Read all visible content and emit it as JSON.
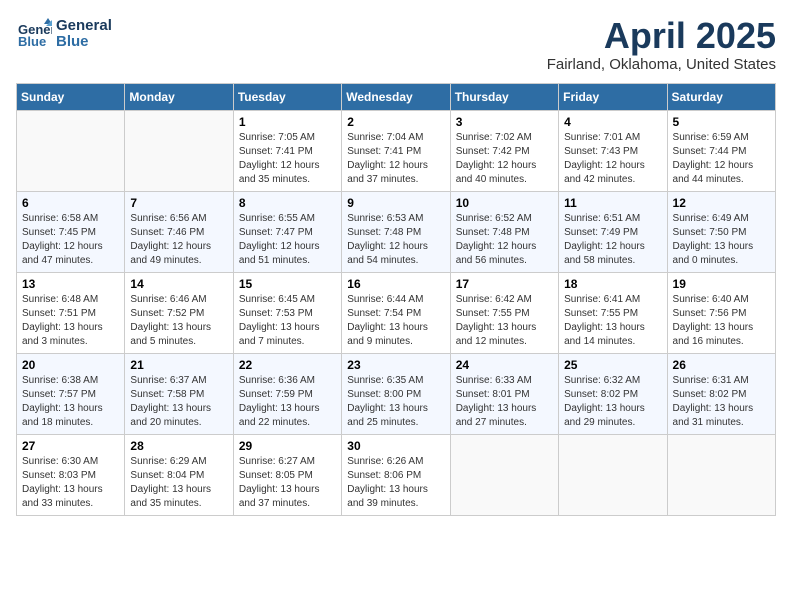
{
  "logo": {
    "line1": "General",
    "line2": "Blue"
  },
  "title": "April 2025",
  "subtitle": "Fairland, Oklahoma, United States",
  "weekdays": [
    "Sunday",
    "Monday",
    "Tuesday",
    "Wednesday",
    "Thursday",
    "Friday",
    "Saturday"
  ],
  "weeks": [
    [
      {
        "day": "",
        "info": ""
      },
      {
        "day": "",
        "info": ""
      },
      {
        "day": "1",
        "info": "Sunrise: 7:05 AM\nSunset: 7:41 PM\nDaylight: 12 hours\nand 35 minutes."
      },
      {
        "day": "2",
        "info": "Sunrise: 7:04 AM\nSunset: 7:41 PM\nDaylight: 12 hours\nand 37 minutes."
      },
      {
        "day": "3",
        "info": "Sunrise: 7:02 AM\nSunset: 7:42 PM\nDaylight: 12 hours\nand 40 minutes."
      },
      {
        "day": "4",
        "info": "Sunrise: 7:01 AM\nSunset: 7:43 PM\nDaylight: 12 hours\nand 42 minutes."
      },
      {
        "day": "5",
        "info": "Sunrise: 6:59 AM\nSunset: 7:44 PM\nDaylight: 12 hours\nand 44 minutes."
      }
    ],
    [
      {
        "day": "6",
        "info": "Sunrise: 6:58 AM\nSunset: 7:45 PM\nDaylight: 12 hours\nand 47 minutes."
      },
      {
        "day": "7",
        "info": "Sunrise: 6:56 AM\nSunset: 7:46 PM\nDaylight: 12 hours\nand 49 minutes."
      },
      {
        "day": "8",
        "info": "Sunrise: 6:55 AM\nSunset: 7:47 PM\nDaylight: 12 hours\nand 51 minutes."
      },
      {
        "day": "9",
        "info": "Sunrise: 6:53 AM\nSunset: 7:48 PM\nDaylight: 12 hours\nand 54 minutes."
      },
      {
        "day": "10",
        "info": "Sunrise: 6:52 AM\nSunset: 7:48 PM\nDaylight: 12 hours\nand 56 minutes."
      },
      {
        "day": "11",
        "info": "Sunrise: 6:51 AM\nSunset: 7:49 PM\nDaylight: 12 hours\nand 58 minutes."
      },
      {
        "day": "12",
        "info": "Sunrise: 6:49 AM\nSunset: 7:50 PM\nDaylight: 13 hours\nand 0 minutes."
      }
    ],
    [
      {
        "day": "13",
        "info": "Sunrise: 6:48 AM\nSunset: 7:51 PM\nDaylight: 13 hours\nand 3 minutes."
      },
      {
        "day": "14",
        "info": "Sunrise: 6:46 AM\nSunset: 7:52 PM\nDaylight: 13 hours\nand 5 minutes."
      },
      {
        "day": "15",
        "info": "Sunrise: 6:45 AM\nSunset: 7:53 PM\nDaylight: 13 hours\nand 7 minutes."
      },
      {
        "day": "16",
        "info": "Sunrise: 6:44 AM\nSunset: 7:54 PM\nDaylight: 13 hours\nand 9 minutes."
      },
      {
        "day": "17",
        "info": "Sunrise: 6:42 AM\nSunset: 7:55 PM\nDaylight: 13 hours\nand 12 minutes."
      },
      {
        "day": "18",
        "info": "Sunrise: 6:41 AM\nSunset: 7:55 PM\nDaylight: 13 hours\nand 14 minutes."
      },
      {
        "day": "19",
        "info": "Sunrise: 6:40 AM\nSunset: 7:56 PM\nDaylight: 13 hours\nand 16 minutes."
      }
    ],
    [
      {
        "day": "20",
        "info": "Sunrise: 6:38 AM\nSunset: 7:57 PM\nDaylight: 13 hours\nand 18 minutes."
      },
      {
        "day": "21",
        "info": "Sunrise: 6:37 AM\nSunset: 7:58 PM\nDaylight: 13 hours\nand 20 minutes."
      },
      {
        "day": "22",
        "info": "Sunrise: 6:36 AM\nSunset: 7:59 PM\nDaylight: 13 hours\nand 22 minutes."
      },
      {
        "day": "23",
        "info": "Sunrise: 6:35 AM\nSunset: 8:00 PM\nDaylight: 13 hours\nand 25 minutes."
      },
      {
        "day": "24",
        "info": "Sunrise: 6:33 AM\nSunset: 8:01 PM\nDaylight: 13 hours\nand 27 minutes."
      },
      {
        "day": "25",
        "info": "Sunrise: 6:32 AM\nSunset: 8:02 PM\nDaylight: 13 hours\nand 29 minutes."
      },
      {
        "day": "26",
        "info": "Sunrise: 6:31 AM\nSunset: 8:02 PM\nDaylight: 13 hours\nand 31 minutes."
      }
    ],
    [
      {
        "day": "27",
        "info": "Sunrise: 6:30 AM\nSunset: 8:03 PM\nDaylight: 13 hours\nand 33 minutes."
      },
      {
        "day": "28",
        "info": "Sunrise: 6:29 AM\nSunset: 8:04 PM\nDaylight: 13 hours\nand 35 minutes."
      },
      {
        "day": "29",
        "info": "Sunrise: 6:27 AM\nSunset: 8:05 PM\nDaylight: 13 hours\nand 37 minutes."
      },
      {
        "day": "30",
        "info": "Sunrise: 6:26 AM\nSunset: 8:06 PM\nDaylight: 13 hours\nand 39 minutes."
      },
      {
        "day": "",
        "info": ""
      },
      {
        "day": "",
        "info": ""
      },
      {
        "day": "",
        "info": ""
      }
    ]
  ]
}
